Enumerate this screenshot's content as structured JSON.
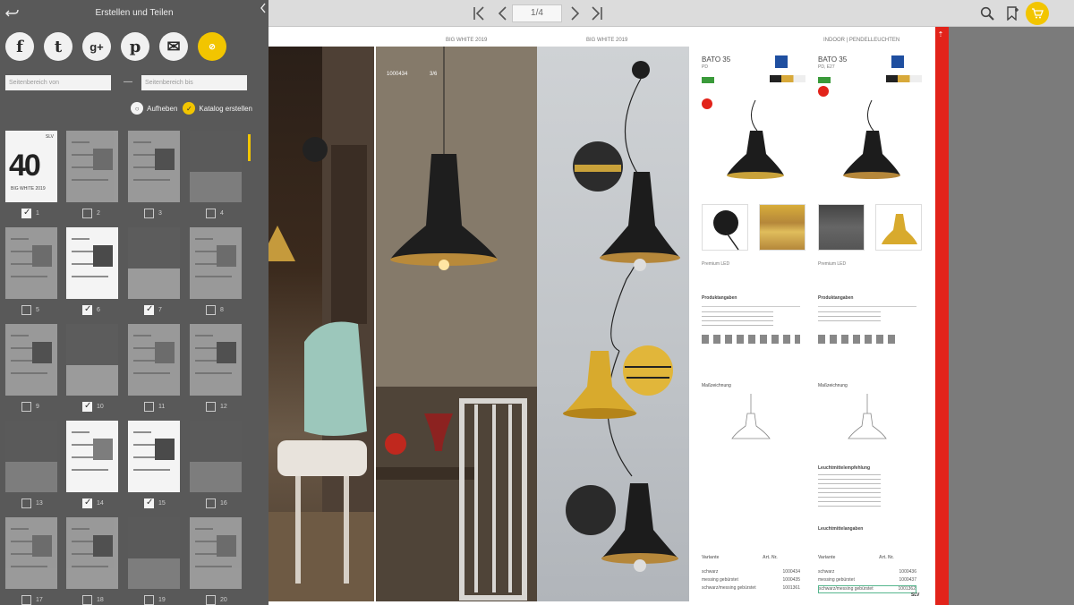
{
  "sidebar": {
    "title": "Erstellen und Teilen",
    "share": [
      {
        "icon": "facebook-icon",
        "glyph": "f"
      },
      {
        "icon": "twitter-icon",
        "glyph": "t"
      },
      {
        "icon": "google-plus-icon",
        "glyph": "g+"
      },
      {
        "icon": "pinterest-icon",
        "glyph": "p"
      },
      {
        "icon": "mail-icon",
        "glyph": "✉"
      },
      {
        "icon": "link-icon",
        "glyph": "⊘"
      }
    ],
    "range_from_placeholder": "Seitenbereich von",
    "range_to_placeholder": "Seitenbereich bis",
    "range_separator": "—",
    "cancel_label": "Aufheben",
    "create_label": "Katalog erstellen",
    "pages": [
      {
        "n": "1",
        "checked": true
      },
      {
        "n": "2",
        "checked": false
      },
      {
        "n": "3",
        "checked": false
      },
      {
        "n": "4",
        "checked": false
      },
      {
        "n": "5",
        "checked": false
      },
      {
        "n": "6",
        "checked": true
      },
      {
        "n": "7",
        "checked": true
      },
      {
        "n": "8",
        "checked": false
      },
      {
        "n": "9",
        "checked": false
      },
      {
        "n": "10",
        "checked": true
      },
      {
        "n": "11",
        "checked": false
      },
      {
        "n": "12",
        "checked": false
      },
      {
        "n": "13",
        "checked": false
      },
      {
        "n": "14",
        "checked": true
      },
      {
        "n": "15",
        "checked": true
      },
      {
        "n": "16",
        "checked": false
      },
      {
        "n": "17",
        "checked": false
      },
      {
        "n": "18",
        "checked": false
      },
      {
        "n": "19",
        "checked": false
      },
      {
        "n": "20",
        "checked": false
      }
    ],
    "cover": {
      "big": "40",
      "sub": "BIG WHITE 2019",
      "brand": "SLV"
    }
  },
  "toolbar": {
    "page_indicator": "1/4",
    "icons": [
      "first-page-icon",
      "prev-page-icon",
      "next-page-icon",
      "last-page-icon",
      "search-icon",
      "bookmark-icon",
      "cart-icon"
    ]
  },
  "spread": {
    "head_left": "BIG WHITE 2019",
    "head_mid": "BIG WHITE 2019",
    "head_right": "INDOOR | PENDELLEUCHTEN",
    "label_photo": "1000434",
    "label_photo_b": "3/6",
    "product_a": {
      "name": "BATO 35",
      "sub": "PD"
    },
    "product_b": {
      "name": "BATO 35",
      "sub": "PD, E27"
    },
    "premium": "Premium LED",
    "premium_b": "Premium LED",
    "sec_tech": "Produktangaben",
    "sec_tech_b": "Produktangaben",
    "sec_draw": "Maßzeichnung",
    "sec_draw_b": "Maßzeichnung",
    "sec_leuchtmittel": "Leuchtmittelempfehlung",
    "sec_leuchtmittel2": "Leuchtmittelangaben",
    "variant_head": "Variante",
    "artnr_head": "Art. Nr.",
    "variants_a": [
      {
        "name": "schwarz",
        "nr": "1000434"
      },
      {
        "name": "messing gebürstet",
        "nr": "1000435"
      },
      {
        "name": "schwarz/messing gebürstet",
        "nr": "1001361"
      }
    ],
    "variants_b": [
      {
        "name": "schwarz",
        "nr": "1000436"
      },
      {
        "name": "messing gebürstet",
        "nr": "1000437"
      },
      {
        "name": "schwarz/messing gebürstet",
        "nr": "1001362"
      }
    ],
    "footer_brand": "SLV"
  },
  "colors": {
    "accent": "#f2c500",
    "red": "#e2231a",
    "panel": "#595959"
  }
}
